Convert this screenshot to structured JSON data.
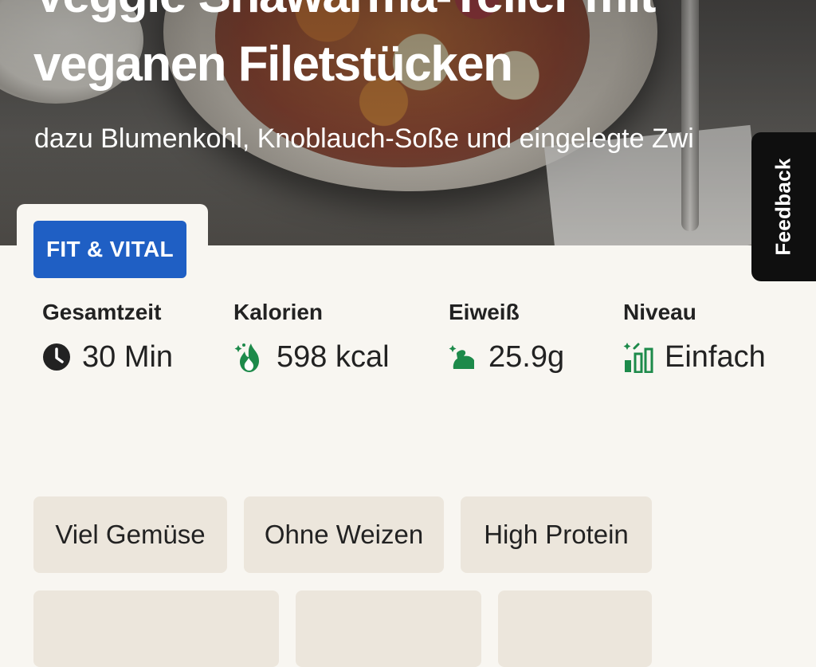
{
  "hero": {
    "title_line1": "Veggie Shawarma-Teller mit",
    "title_line2": "veganen Filetstücken",
    "subtitle": "dazu Blumenkohl, Knoblauch-Soße und eingelegte Zwi"
  },
  "badge": {
    "label": "FIT & VITAL",
    "color": "#1f5fc4"
  },
  "feedback": {
    "label": "Feedback"
  },
  "stats": [
    {
      "label": "Gesamtzeit",
      "value": "30 Min",
      "icon": "clock-icon"
    },
    {
      "label": "Kalorien",
      "value": "598 kcal",
      "icon": "flame-icon"
    },
    {
      "label": "Eiweiß",
      "value": "25.9g",
      "icon": "muscle-icon"
    },
    {
      "label": "Niveau",
      "value": "Einfach",
      "icon": "difficulty-bars-icon"
    }
  ],
  "tags": [
    "Viel Gemüse",
    "Ohne Weizen",
    "High Protein",
    "",
    "",
    ""
  ],
  "colors": {
    "accent_green": "#1d8a4a",
    "tag_bg": "#ece6dc",
    "page_bg": "#f8f6f1"
  }
}
